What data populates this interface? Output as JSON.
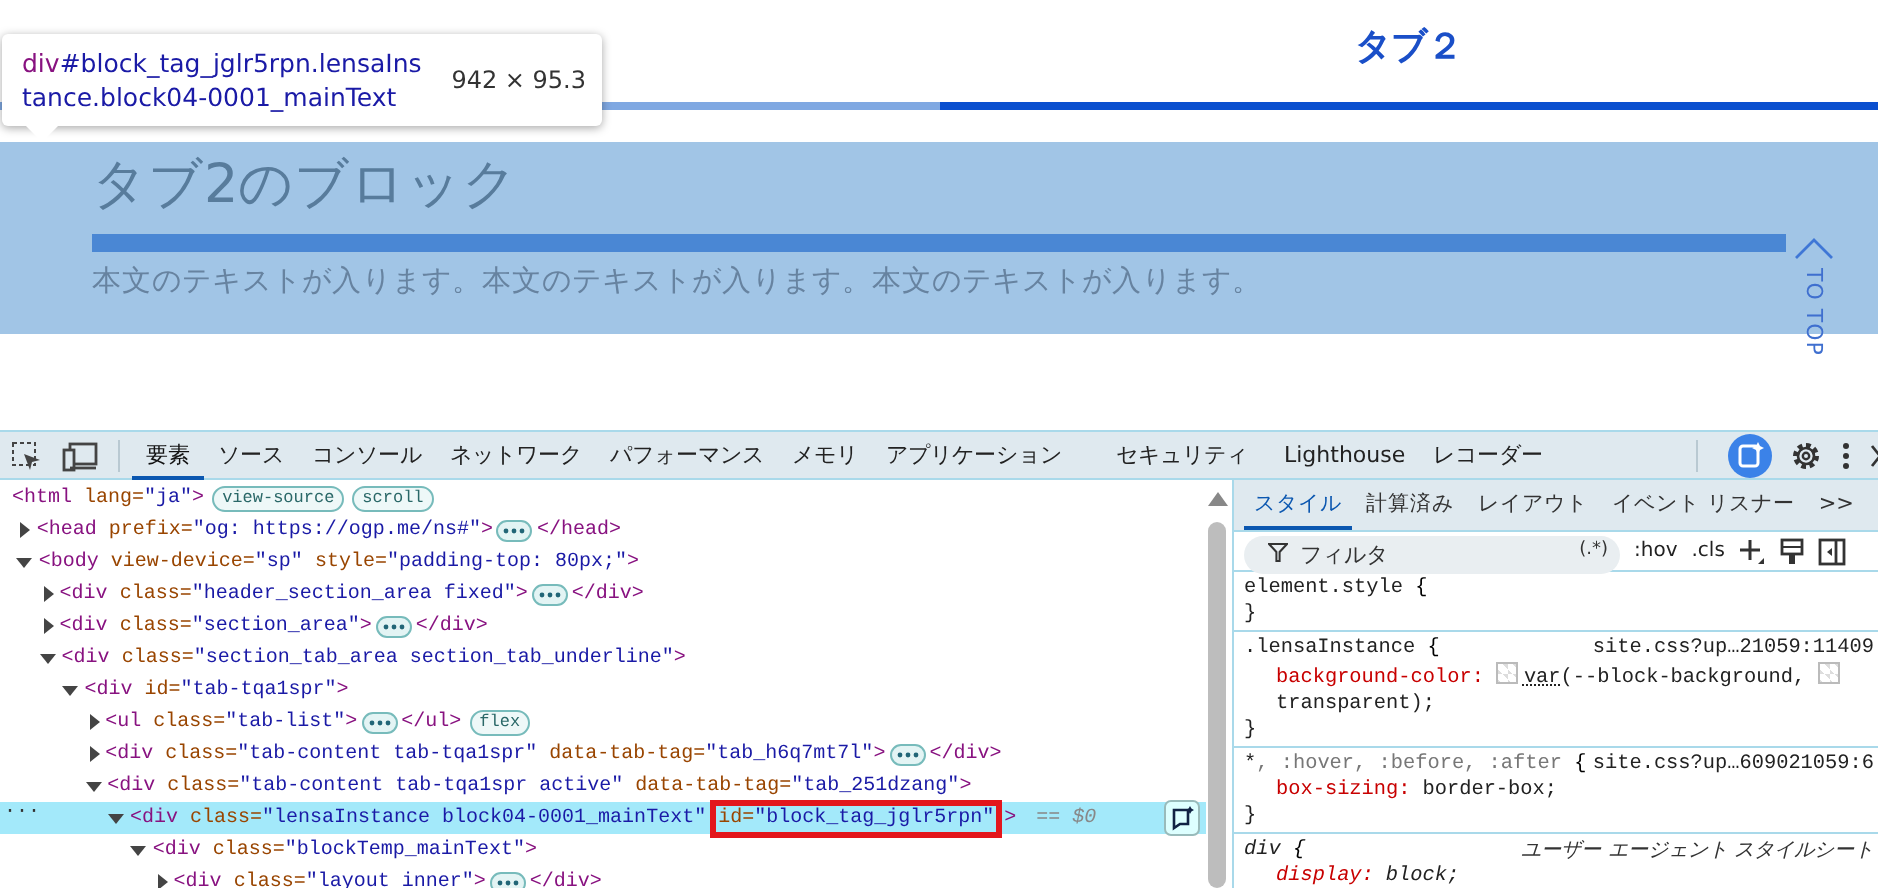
{
  "page": {
    "tabs": [
      {
        "selected": false
      },
      {
        "label": "タブ２",
        "selected": true
      }
    ],
    "block": {
      "highlighted": true,
      "heading": "タブ2のブロック",
      "text": "本文のテキストが入ります。本文のテキストが入ります。本文のテキストが入ります。"
    },
    "to_top": "TO TOP",
    "tooltip": {
      "tag": "div",
      "selector": "#block_tag_jglr5rpn.lensaInstance.block04-0001_mainText",
      "size": "942 × 95.3"
    }
  },
  "devtools": {
    "tabs": [
      {
        "label": "要素",
        "selected": true
      },
      {
        "label": "ソース",
        "selected": false
      },
      {
        "label": "コンソール",
        "selected": false
      },
      {
        "label": "ネットワーク",
        "selected": false
      },
      {
        "label": "パフォーマンス",
        "selected": false
      },
      {
        "label": "メモリ",
        "selected": false
      },
      {
        "label": "アプリケーション",
        "selected": false
      },
      {
        "label": "セキュリティ",
        "selected": false
      },
      {
        "label": "Lighthouse",
        "selected": false
      },
      {
        "label": "レコーダー",
        "selected": false
      }
    ],
    "dom": [
      {
        "open": "<html",
        "attrs": [
          {
            "name": "lang=",
            "value": "\"ja\""
          }
        ],
        "close": ">",
        "badges": [
          "view-source",
          "scroll"
        ],
        "children": [
          {
            "open": "<head",
            "expanded": false,
            "attrs": [
              {
                "name": "prefix=",
                "value": "\"og: https://ogp.me/ns#\""
              }
            ],
            "close": ">",
            "ellipsis": true,
            "end": "</head>"
          },
          {
            "open": "<body",
            "expanded": true,
            "attrs": [
              {
                "name": "view-device=",
                "value": "\"sp\""
              },
              {
                "name": "style=",
                "value": "\"padding-top: 80px;\""
              }
            ],
            "close": ">",
            "children": [
              {
                "open": "<div",
                "expanded": false,
                "attrs": [
                  {
                    "name": "class=",
                    "value": "\"header_section_area fixed\""
                  }
                ],
                "close": ">",
                "ellipsis": true,
                "end": "</div>"
              },
              {
                "open": "<div",
                "expanded": false,
                "attrs": [
                  {
                    "name": "class=",
                    "value": "\"section_area\""
                  }
                ],
                "close": ">",
                "ellipsis": true,
                "end": "</div>"
              },
              {
                "open": "<div",
                "expanded": true,
                "attrs": [
                  {
                    "name": "class=",
                    "value": "\"section_tab_area section_tab_underline\""
                  }
                ],
                "close": ">",
                "children": [
                  {
                    "open": "<div",
                    "expanded": true,
                    "attrs": [
                      {
                        "name": "id=",
                        "value": "\"tab-tqa1spr\""
                      }
                    ],
                    "close": ">",
                    "children": [
                      {
                        "open": "<ul",
                        "expanded": false,
                        "attrs": [
                          {
                            "name": "class=",
                            "value": "\"tab-list\""
                          }
                        ],
                        "close": ">",
                        "ellipsis": true,
                        "end": "</ul>",
                        "badges": [
                          "flex"
                        ]
                      },
                      {
                        "open": "<div",
                        "expanded": false,
                        "attrs": [
                          {
                            "name": "class=",
                            "value": "\"tab-content tab-tqa1spr\""
                          },
                          {
                            "name": "data-tab-tag=",
                            "value": "\"tab_h6q7mt7l\""
                          }
                        ],
                        "close": ">",
                        "ellipsis": true,
                        "end": "</div>"
                      },
                      {
                        "open": "<div",
                        "expanded": true,
                        "attrs": [
                          {
                            "name": "class=",
                            "value": "\"tab-content tab-tqa1spr active\""
                          },
                          {
                            "name": "data-tab-tag=",
                            "value": "\"tab_251dzang\""
                          }
                        ],
                        "close": ">",
                        "children": [
                          {
                            "open": "<div",
                            "expanded": true,
                            "selected": true,
                            "attrs": [
                              {
                                "name": "class=",
                                "value": "\"lensaInstance block04-0001_mainText\""
                              },
                              {
                                "name": "id=",
                                "value": "\"block_tag_jglr5rpn\"",
                                "boxed": true
                              }
                            ],
                            "close": ">",
                            "marker": "== $0",
                            "lead": "···",
                            "children": [
                              {
                                "open": "<div",
                                "expanded": true,
                                "attrs": [
                                  {
                                    "name": "class=",
                                    "value": "\"blockTemp_mainText\""
                                  }
                                ],
                                "close": ">",
                                "children": [
                                  {
                                    "open": "<div",
                                    "expanded": false,
                                    "attrs": [
                                      {
                                        "name": "class=",
                                        "value": "\"layout inner\""
                                      }
                                    ],
                                    "close": ">",
                                    "ellipsis": true,
                                    "end": "</div>"
                                  }
                                ]
                              }
                            ]
                          }
                        ]
                      }
                    ]
                  }
                ]
              }
            ]
          }
        ]
      }
    ],
    "styles": {
      "tabs": [
        {
          "label": "スタイル",
          "selected": true
        },
        {
          "label": "計算済み",
          "selected": false
        },
        {
          "label": "レイアウト",
          "selected": false
        },
        {
          "label": "イベント リスナー",
          "selected": false
        },
        {
          "label": ">>",
          "selected": false
        }
      ],
      "filter": {
        "placeholder": "フィルタ"
      },
      "tools": [
        "(.*)",
        ":hov",
        ".cls"
      ],
      "rules": [
        {
          "selector": [
            {
              "text": "element.style",
              "matched": true
            }
          ],
          "open": "{",
          "close": "}"
        },
        {
          "selector": [
            {
              "text": ".lensaInstance",
              "matched": true
            }
          ],
          "open": "{",
          "source": "site.css?up…21059:11409",
          "close": "}",
          "declarations": [
            {
              "property": "background-color:",
              "value": [
                {
                  "kind": "swatch"
                },
                {
                  "kind": "link",
                  "text": "var"
                },
                {
                  "kind": "text",
                  "text": "(--block-background,"
                },
                {
                  "kind": "swatch"
                },
                {
                  "kind": "text",
                  "text": "transparent);"
                }
              ]
            }
          ]
        },
        {
          "selector": [
            {
              "text": "*",
              "matched": true
            },
            {
              "text": ", :hover, :before, :after",
              "matched": false
            }
          ],
          "open": "{",
          "source": "site.css?up…609021059:6",
          "close": "}",
          "declarations": [
            {
              "property": "box-sizing:",
              "value": [
                {
                  "kind": "text",
                  "text": "border-box;"
                }
              ]
            }
          ]
        },
        {
          "selector": [
            {
              "text": "div",
              "matched": true
            }
          ],
          "open": "{",
          "source": "ユーザー エージェント スタイルシート",
          "user_agent": true,
          "declarations": [
            {
              "property": "display:",
              "value": [
                {
                  "kind": "text",
                  "text": "block;"
                }
              ]
            }
          ]
        }
      ]
    }
  }
}
